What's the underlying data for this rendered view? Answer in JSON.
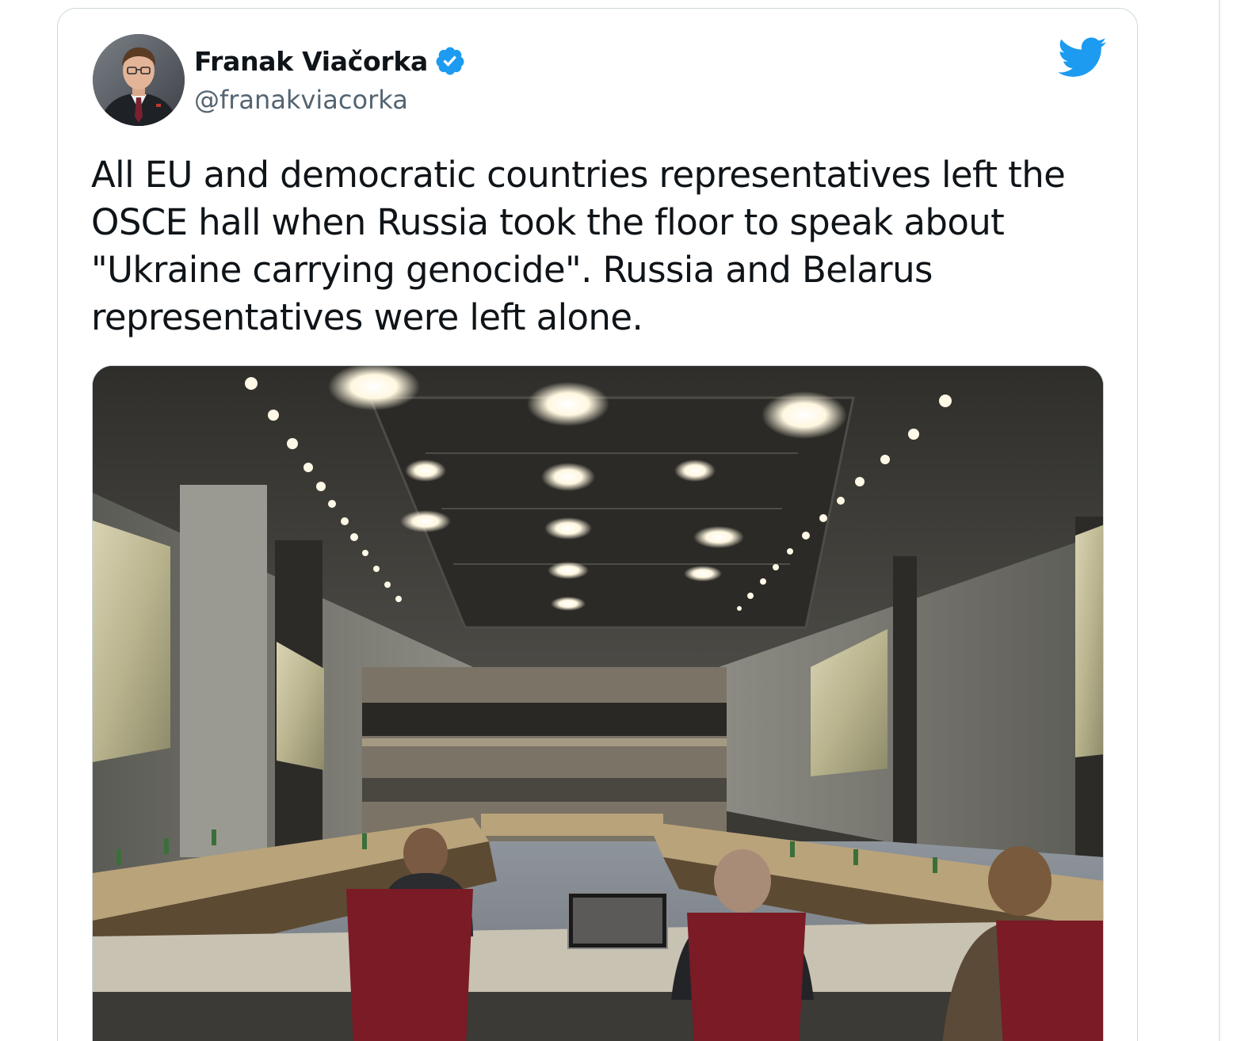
{
  "tweet": {
    "author": {
      "display_name": "Franak Viačorka",
      "handle": "@franakviacorka",
      "verified": true,
      "avatar_icon": "avatar-photo"
    },
    "platform_icon": "twitter-bird-icon",
    "text": "All EU and democratic countries representatives left the OSCE hall when Russia took the floor to speak about \"Ukraine carrying genocide\". Russia and Belarus representatives were left alone.",
    "media": {
      "type": "photo",
      "alt": "OSCE hall photo"
    }
  },
  "colors": {
    "brand_blue": "#1d9bf0",
    "text_primary": "#0f1419",
    "text_secondary": "#536471",
    "border": "#cfd9de"
  }
}
